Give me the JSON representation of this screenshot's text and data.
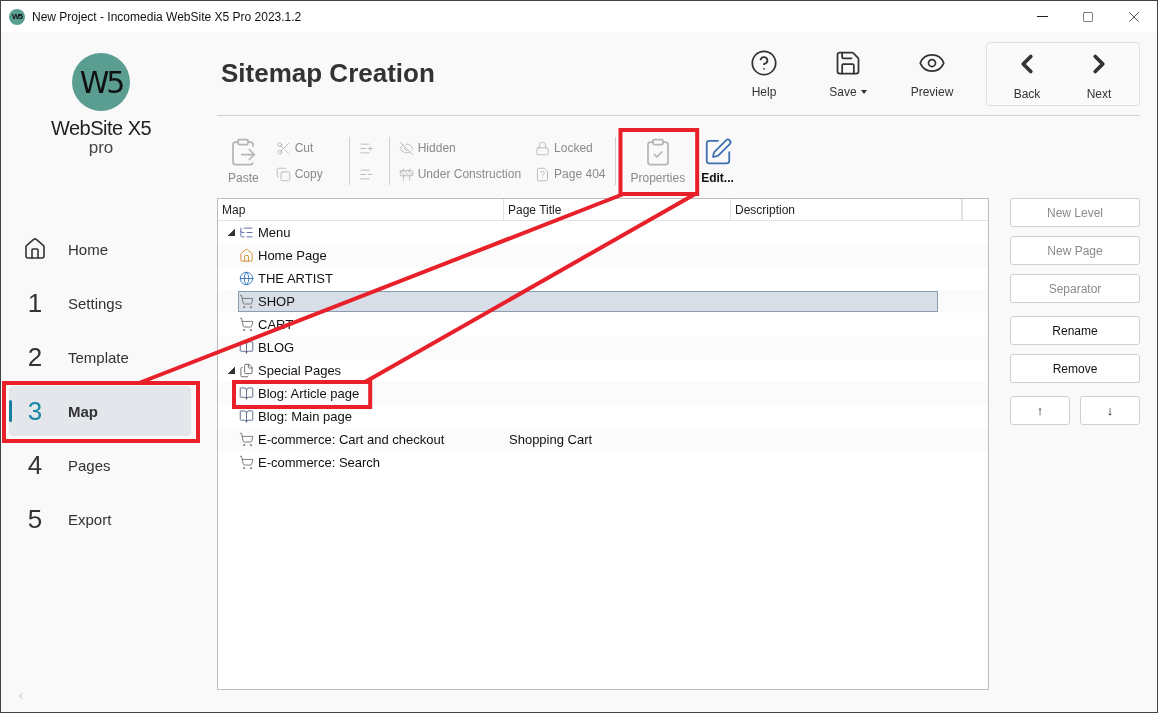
{
  "window": {
    "icon_text": "W5",
    "title": "New Project - Incomedia WebSite X5 Pro 2023.1.2"
  },
  "logo": {
    "mark": "W5",
    "name": "WebSite X5",
    "edition": "pro"
  },
  "sidebar": {
    "items": [
      {
        "kind": "home",
        "label": "Home",
        "selected": false
      },
      {
        "kind": "step",
        "number": "1",
        "label": "Settings",
        "selected": false
      },
      {
        "kind": "step",
        "number": "2",
        "label": "Template",
        "selected": false
      },
      {
        "kind": "step",
        "number": "3",
        "label": "Map",
        "selected": true
      },
      {
        "kind": "step",
        "number": "4",
        "label": "Pages",
        "selected": false
      },
      {
        "kind": "step",
        "number": "5",
        "label": "Export",
        "selected": false
      }
    ]
  },
  "header": {
    "title": "Sitemap Creation",
    "actions": [
      {
        "kind": "help",
        "label": "Help",
        "dropdown": false
      },
      {
        "kind": "save",
        "label": "Save",
        "dropdown": true
      },
      {
        "kind": "preview",
        "label": "Preview",
        "dropdown": false
      }
    ],
    "navigation": [
      {
        "kind": "back",
        "label": "Back"
      },
      {
        "kind": "next",
        "label": "Next"
      }
    ]
  },
  "toolbar": {
    "groups": [
      {
        "kind": "large",
        "items": [
          {
            "kind": "paste",
            "label": "Paste",
            "disabled": true
          }
        ]
      },
      {
        "kind": "small",
        "items": [
          {
            "kind": "cut",
            "label": "Cut",
            "disabled": true
          },
          {
            "kind": "copy",
            "label": "Copy",
            "disabled": true
          }
        ]
      },
      {
        "kind": "small",
        "items": [
          {
            "kind": "level-add",
            "disabled": true
          },
          {
            "kind": "level-remove",
            "disabled": true
          }
        ]
      },
      {
        "kind": "small",
        "items": [
          {
            "kind": "hidden",
            "label": "Hidden",
            "disabled": true
          },
          {
            "kind": "construction",
            "label": "Under Construction",
            "disabled": true
          }
        ]
      },
      {
        "kind": "small",
        "items": [
          {
            "kind": "locked",
            "label": "Locked",
            "disabled": true
          },
          {
            "kind": "page404",
            "label": "Page 404",
            "disabled": true
          }
        ]
      },
      {
        "kind": "large",
        "items": [
          {
            "kind": "properties",
            "label": "Properties",
            "disabled": true
          },
          {
            "kind": "edit",
            "label": "Edit...",
            "disabled": false
          }
        ]
      }
    ]
  },
  "tree": {
    "columns": [
      "Map",
      "Page Title",
      "Description"
    ],
    "nodes": [
      {
        "kind": "menu",
        "label": "Menu",
        "expanded": true,
        "selected": false,
        "children": [
          {
            "kind": "home",
            "label": "Home Page",
            "selected": false
          },
          {
            "kind": "linked-page",
            "label": "THE ARTIST",
            "selected": false
          },
          {
            "kind": "cart",
            "label": "SHOP",
            "selected": true
          },
          {
            "kind": "cart",
            "label": "CART",
            "selected": false
          },
          {
            "kind": "blog",
            "label": "BLOG",
            "selected": false
          }
        ]
      },
      {
        "kind": "special",
        "label": "Special Pages",
        "expanded": true,
        "selected": false,
        "children": [
          {
            "kind": "blog",
            "label": "Blog: Article page",
            "selected": false
          },
          {
            "kind": "blog",
            "label": "Blog: Main page",
            "selected": false
          },
          {
            "kind": "cart",
            "label": "E-commerce: Cart and checkout",
            "page_title": "Shopping Cart",
            "selected": false
          },
          {
            "kind": "cart",
            "label": "E-commerce: Search",
            "selected": false
          }
        ]
      }
    ]
  },
  "side_buttons": [
    {
      "label": "New Level",
      "disabled": true
    },
    {
      "label": "New Page",
      "disabled": true
    },
    {
      "label": "Separator",
      "disabled": true
    },
    {
      "label": "Rename",
      "disabled": false
    },
    {
      "label": "Remove",
      "disabled": false
    }
  ],
  "move_buttons": [
    {
      "label": "↑",
      "disabled": false
    },
    {
      "label": "↓",
      "disabled": false
    }
  ]
}
